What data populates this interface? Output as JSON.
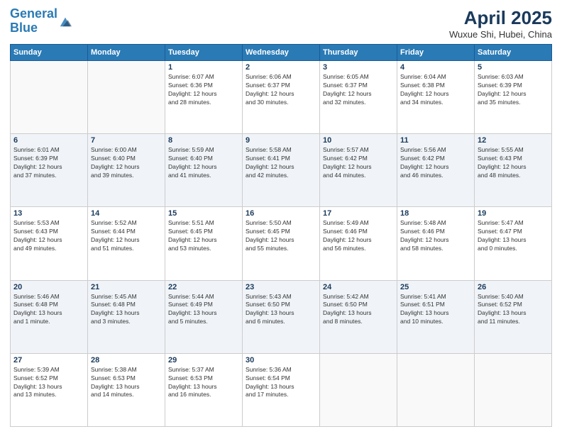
{
  "header": {
    "logo_line1": "General",
    "logo_line2": "Blue",
    "main_title": "April 2025",
    "sub_title": "Wuxue Shi, Hubei, China"
  },
  "weekdays": [
    "Sunday",
    "Monday",
    "Tuesday",
    "Wednesday",
    "Thursday",
    "Friday",
    "Saturday"
  ],
  "weeks": [
    [
      {
        "day": "",
        "info": ""
      },
      {
        "day": "",
        "info": ""
      },
      {
        "day": "1",
        "info": "Sunrise: 6:07 AM\nSunset: 6:36 PM\nDaylight: 12 hours\nand 28 minutes."
      },
      {
        "day": "2",
        "info": "Sunrise: 6:06 AM\nSunset: 6:37 PM\nDaylight: 12 hours\nand 30 minutes."
      },
      {
        "day": "3",
        "info": "Sunrise: 6:05 AM\nSunset: 6:37 PM\nDaylight: 12 hours\nand 32 minutes."
      },
      {
        "day": "4",
        "info": "Sunrise: 6:04 AM\nSunset: 6:38 PM\nDaylight: 12 hours\nand 34 minutes."
      },
      {
        "day": "5",
        "info": "Sunrise: 6:03 AM\nSunset: 6:39 PM\nDaylight: 12 hours\nand 35 minutes."
      }
    ],
    [
      {
        "day": "6",
        "info": "Sunrise: 6:01 AM\nSunset: 6:39 PM\nDaylight: 12 hours\nand 37 minutes."
      },
      {
        "day": "7",
        "info": "Sunrise: 6:00 AM\nSunset: 6:40 PM\nDaylight: 12 hours\nand 39 minutes."
      },
      {
        "day": "8",
        "info": "Sunrise: 5:59 AM\nSunset: 6:40 PM\nDaylight: 12 hours\nand 41 minutes."
      },
      {
        "day": "9",
        "info": "Sunrise: 5:58 AM\nSunset: 6:41 PM\nDaylight: 12 hours\nand 42 minutes."
      },
      {
        "day": "10",
        "info": "Sunrise: 5:57 AM\nSunset: 6:42 PM\nDaylight: 12 hours\nand 44 minutes."
      },
      {
        "day": "11",
        "info": "Sunrise: 5:56 AM\nSunset: 6:42 PM\nDaylight: 12 hours\nand 46 minutes."
      },
      {
        "day": "12",
        "info": "Sunrise: 5:55 AM\nSunset: 6:43 PM\nDaylight: 12 hours\nand 48 minutes."
      }
    ],
    [
      {
        "day": "13",
        "info": "Sunrise: 5:53 AM\nSunset: 6:43 PM\nDaylight: 12 hours\nand 49 minutes."
      },
      {
        "day": "14",
        "info": "Sunrise: 5:52 AM\nSunset: 6:44 PM\nDaylight: 12 hours\nand 51 minutes."
      },
      {
        "day": "15",
        "info": "Sunrise: 5:51 AM\nSunset: 6:45 PM\nDaylight: 12 hours\nand 53 minutes."
      },
      {
        "day": "16",
        "info": "Sunrise: 5:50 AM\nSunset: 6:45 PM\nDaylight: 12 hours\nand 55 minutes."
      },
      {
        "day": "17",
        "info": "Sunrise: 5:49 AM\nSunset: 6:46 PM\nDaylight: 12 hours\nand 56 minutes."
      },
      {
        "day": "18",
        "info": "Sunrise: 5:48 AM\nSunset: 6:46 PM\nDaylight: 12 hours\nand 58 minutes."
      },
      {
        "day": "19",
        "info": "Sunrise: 5:47 AM\nSunset: 6:47 PM\nDaylight: 13 hours\nand 0 minutes."
      }
    ],
    [
      {
        "day": "20",
        "info": "Sunrise: 5:46 AM\nSunset: 6:48 PM\nDaylight: 13 hours\nand 1 minute."
      },
      {
        "day": "21",
        "info": "Sunrise: 5:45 AM\nSunset: 6:48 PM\nDaylight: 13 hours\nand 3 minutes."
      },
      {
        "day": "22",
        "info": "Sunrise: 5:44 AM\nSunset: 6:49 PM\nDaylight: 13 hours\nand 5 minutes."
      },
      {
        "day": "23",
        "info": "Sunrise: 5:43 AM\nSunset: 6:50 PM\nDaylight: 13 hours\nand 6 minutes."
      },
      {
        "day": "24",
        "info": "Sunrise: 5:42 AM\nSunset: 6:50 PM\nDaylight: 13 hours\nand 8 minutes."
      },
      {
        "day": "25",
        "info": "Sunrise: 5:41 AM\nSunset: 6:51 PM\nDaylight: 13 hours\nand 10 minutes."
      },
      {
        "day": "26",
        "info": "Sunrise: 5:40 AM\nSunset: 6:52 PM\nDaylight: 13 hours\nand 11 minutes."
      }
    ],
    [
      {
        "day": "27",
        "info": "Sunrise: 5:39 AM\nSunset: 6:52 PM\nDaylight: 13 hours\nand 13 minutes."
      },
      {
        "day": "28",
        "info": "Sunrise: 5:38 AM\nSunset: 6:53 PM\nDaylight: 13 hours\nand 14 minutes."
      },
      {
        "day": "29",
        "info": "Sunrise: 5:37 AM\nSunset: 6:53 PM\nDaylight: 13 hours\nand 16 minutes."
      },
      {
        "day": "30",
        "info": "Sunrise: 5:36 AM\nSunset: 6:54 PM\nDaylight: 13 hours\nand 17 minutes."
      },
      {
        "day": "",
        "info": ""
      },
      {
        "day": "",
        "info": ""
      },
      {
        "day": "",
        "info": ""
      }
    ]
  ]
}
